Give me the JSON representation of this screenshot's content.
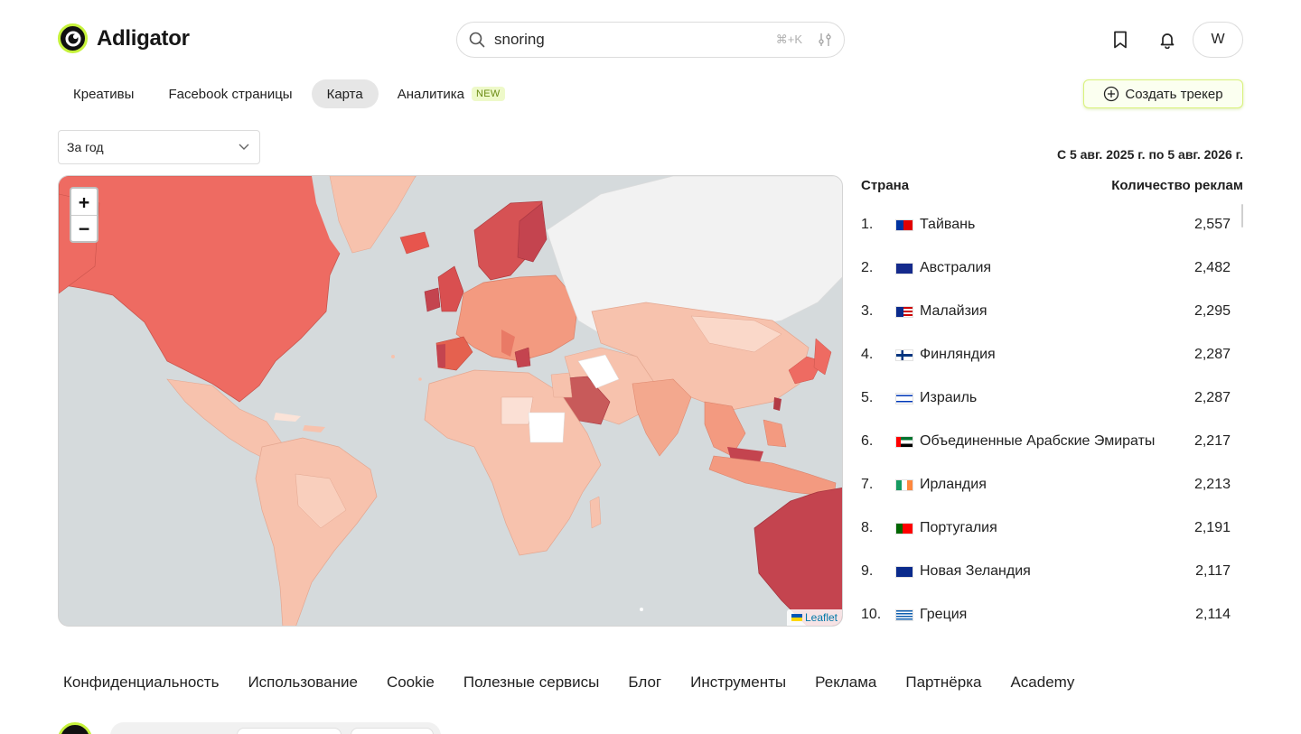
{
  "app": {
    "name": "Adligator"
  },
  "search": {
    "value": "snoring",
    "shortcut": "⌘+K"
  },
  "header": {
    "avatar_letter": "W"
  },
  "tabs": [
    {
      "label": "Креативы",
      "active": false
    },
    {
      "label": "Facebook страницы",
      "active": false
    },
    {
      "label": "Карта",
      "active": true
    },
    {
      "label": "Аналитика",
      "active": false,
      "badge": "NEW"
    }
  ],
  "tracker_button": {
    "label": "Создать трекер"
  },
  "period": {
    "selected": "За год"
  },
  "date_range": "С 5 авг. 2025 г. по 5 авг. 2026 г.",
  "map": {
    "zoom_in": "+",
    "zoom_out": "−",
    "attribution": "Leaflet"
  },
  "table": {
    "col_country": "Страна",
    "col_count": "Количество реклам",
    "rows": [
      {
        "rank": "1.",
        "flag": "tw",
        "country": "Тайвань",
        "count": "2,557"
      },
      {
        "rank": "2.",
        "flag": "au",
        "country": "Австралия",
        "count": "2,482"
      },
      {
        "rank": "3.",
        "flag": "my",
        "country": "Малайзия",
        "count": "2,295"
      },
      {
        "rank": "4.",
        "flag": "fi",
        "country": "Финляндия",
        "count": "2,287"
      },
      {
        "rank": "5.",
        "flag": "il",
        "country": "Израиль",
        "count": "2,287"
      },
      {
        "rank": "6.",
        "flag": "ae",
        "country": "Объединенные Арабские Эмираты",
        "count": "2,217"
      },
      {
        "rank": "7.",
        "flag": "ie",
        "country": "Ирландия",
        "count": "2,213"
      },
      {
        "rank": "8.",
        "flag": "pt",
        "country": "Португалия",
        "count": "2,191"
      },
      {
        "rank": "9.",
        "flag": "nz",
        "country": "Новая Зеландия",
        "count": "2,117"
      },
      {
        "rank": "10.",
        "flag": "gr",
        "country": "Греция",
        "count": "2,114"
      }
    ]
  },
  "footer": {
    "links": [
      "Конфиденциальность",
      "Использование",
      "Cookie",
      "Полезные сервисы",
      "Блог",
      "Инструменты",
      "Реклама",
      "Партнёрка",
      "Academy"
    ]
  },
  "colors": {
    "accent": "#c6f23c",
    "map_ocean": "#d5dadc",
    "heat_high": "#c4444f",
    "heat_mid": "#ee6b62",
    "heat_low": "#f7c2ad",
    "heat_none": "#f2f2f2"
  }
}
